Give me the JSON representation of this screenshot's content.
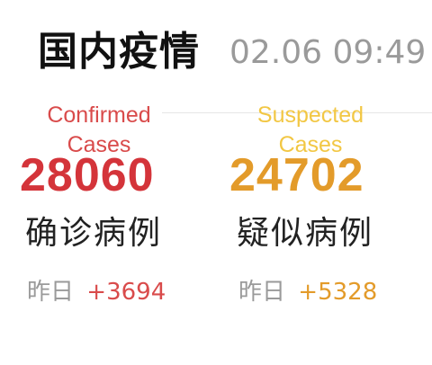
{
  "header": {
    "title": "国内疫情",
    "timestamp": "02.06 09:49"
  },
  "colors": {
    "confirmed_red": "#d4343a",
    "suspected_orange": "#e39b2a",
    "suspected_label_yellow": "#f2c744",
    "muted_gray": "#9a9a9a"
  },
  "cards": {
    "confirmed": {
      "label_en": "Confirmed Cases",
      "value": "28060",
      "label_zh": "确诊病例",
      "delta_label": "昨日",
      "delta_value": "+3694"
    },
    "suspected": {
      "label_en": "Suspected Cases",
      "value": "24702",
      "label_zh": "疑似病例",
      "delta_label": "昨日",
      "delta_value": "+5328"
    }
  }
}
